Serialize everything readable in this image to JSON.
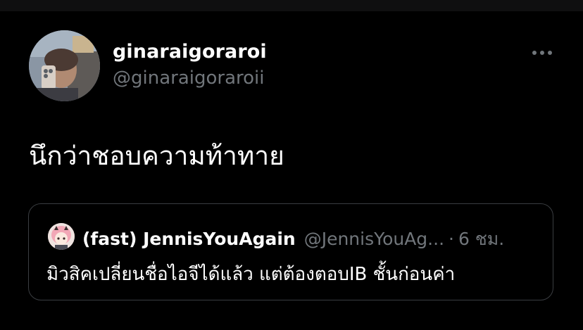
{
  "tweet": {
    "author": {
      "display_name": "ginaraigoraroi",
      "handle": "@ginaraigoraroii"
    },
    "text": "นึกว่าชอบความท้าทาย",
    "more_icon": "more-horizontal-icon"
  },
  "quoted_tweet": {
    "author": {
      "display_name": "(fast) JennisYouAgain",
      "handle": "@JennisYouAg..."
    },
    "separator": "·",
    "time": "6 ชม.",
    "text": "มิวสิคเปลี่ยนชื่อไอจีได้แล้ว แต่ต้องตอบIB ชั้นก่อนค่า"
  },
  "colors": {
    "background": "#000000",
    "primary_text": "#ffffff",
    "secondary_text": "#71767b",
    "card_border": "#3a3d41"
  }
}
